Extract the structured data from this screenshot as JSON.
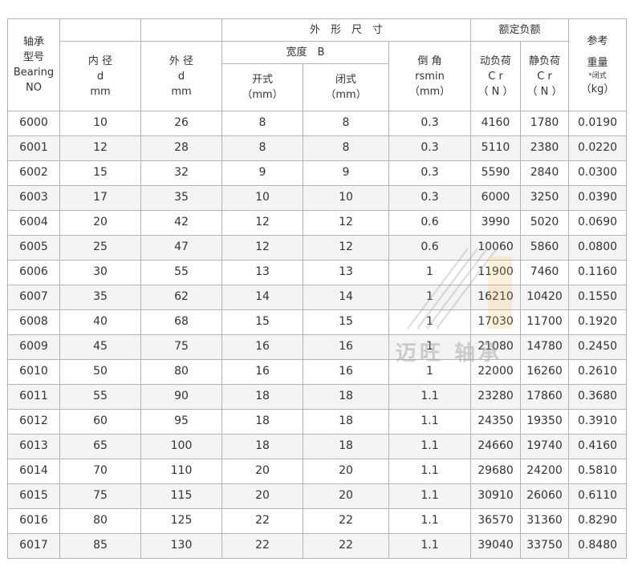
{
  "header": {
    "model": [
      "轴承",
      "型号",
      "Bearing",
      "NO"
    ],
    "inner": [
      "内 径",
      "d",
      "mm"
    ],
    "outer": [
      "外 径",
      "d",
      "mm"
    ],
    "dimensions": "外　形　尺　寸",
    "width": "宽度　B",
    "open": [
      "开式",
      "（mm）"
    ],
    "closed": [
      "闭式",
      "（mm）"
    ],
    "chamfer": [
      "倒 角",
      "rsmin",
      "（mm）"
    ],
    "rated_load": "额定负额",
    "dynamic": [
      "动负荷",
      "C r",
      "（ N ）"
    ],
    "static": [
      "静负荷",
      "C r",
      "（ N ）"
    ],
    "weight": [
      "参考",
      "重量",
      "*闭式",
      "（kg）"
    ]
  },
  "rows": [
    [
      "6000",
      "10",
      "26",
      "8",
      "8",
      "0.3",
      "4160",
      "1780",
      "0.0190"
    ],
    [
      "6001",
      "12",
      "28",
      "8",
      "8",
      "0.3",
      "5110",
      "2380",
      "0.0220"
    ],
    [
      "6002",
      "15",
      "32",
      "9",
      "9",
      "0.3",
      "5590",
      "2840",
      "0.0300"
    ],
    [
      "6003",
      "17",
      "35",
      "10",
      "10",
      "0.3",
      "6000",
      "3250",
      "0.0390"
    ],
    [
      "6004",
      "20",
      "42",
      "12",
      "12",
      "0.6",
      "3990",
      "5020",
      "0.0690"
    ],
    [
      "6005",
      "25",
      "47",
      "12",
      "12",
      "0.6",
      "10060",
      "5860",
      "0.0800"
    ],
    [
      "6006",
      "30",
      "55",
      "13",
      "13",
      "1",
      "11900",
      "7460",
      "0.1160"
    ],
    [
      "6007",
      "35",
      "62",
      "14",
      "14",
      "1",
      "16210",
      "10420",
      "0.1550"
    ],
    [
      "6008",
      "40",
      "68",
      "15",
      "15",
      "1",
      "17030",
      "11700",
      "0.1920"
    ],
    [
      "6009",
      "45",
      "75",
      "16",
      "16",
      "1",
      "21080",
      "14780",
      "0.2450"
    ],
    [
      "6010",
      "50",
      "80",
      "16",
      "16",
      "1",
      "22000",
      "16260",
      "0.2610"
    ],
    [
      "6011",
      "55",
      "90",
      "18",
      "18",
      "1.1",
      "23280",
      "17860",
      "0.3680"
    ],
    [
      "6012",
      "60",
      "95",
      "18",
      "18",
      "1.1",
      "24350",
      "19350",
      "0.3910"
    ],
    [
      "6013",
      "65",
      "100",
      "18",
      "18",
      "1.1",
      "24660",
      "19740",
      "0.4160"
    ],
    [
      "6014",
      "70",
      "110",
      "20",
      "20",
      "1.1",
      "29680",
      "24200",
      "0.5810"
    ],
    [
      "6015",
      "75",
      "115",
      "20",
      "20",
      "1.1",
      "30910",
      "26060",
      "0.6110"
    ],
    [
      "6016",
      "80",
      "125",
      "22",
      "22",
      "1.1",
      "36570",
      "31360",
      "0.8290"
    ],
    [
      "6017",
      "85",
      "130",
      "22",
      "22",
      "1.1",
      "39040",
      "33750",
      "0.8480"
    ]
  ],
  "watermark": "迈旺 轴承",
  "colors": {
    "border": "#b4b4b4",
    "text": "#333333",
    "watermark_accent": "#f2b23a"
  }
}
